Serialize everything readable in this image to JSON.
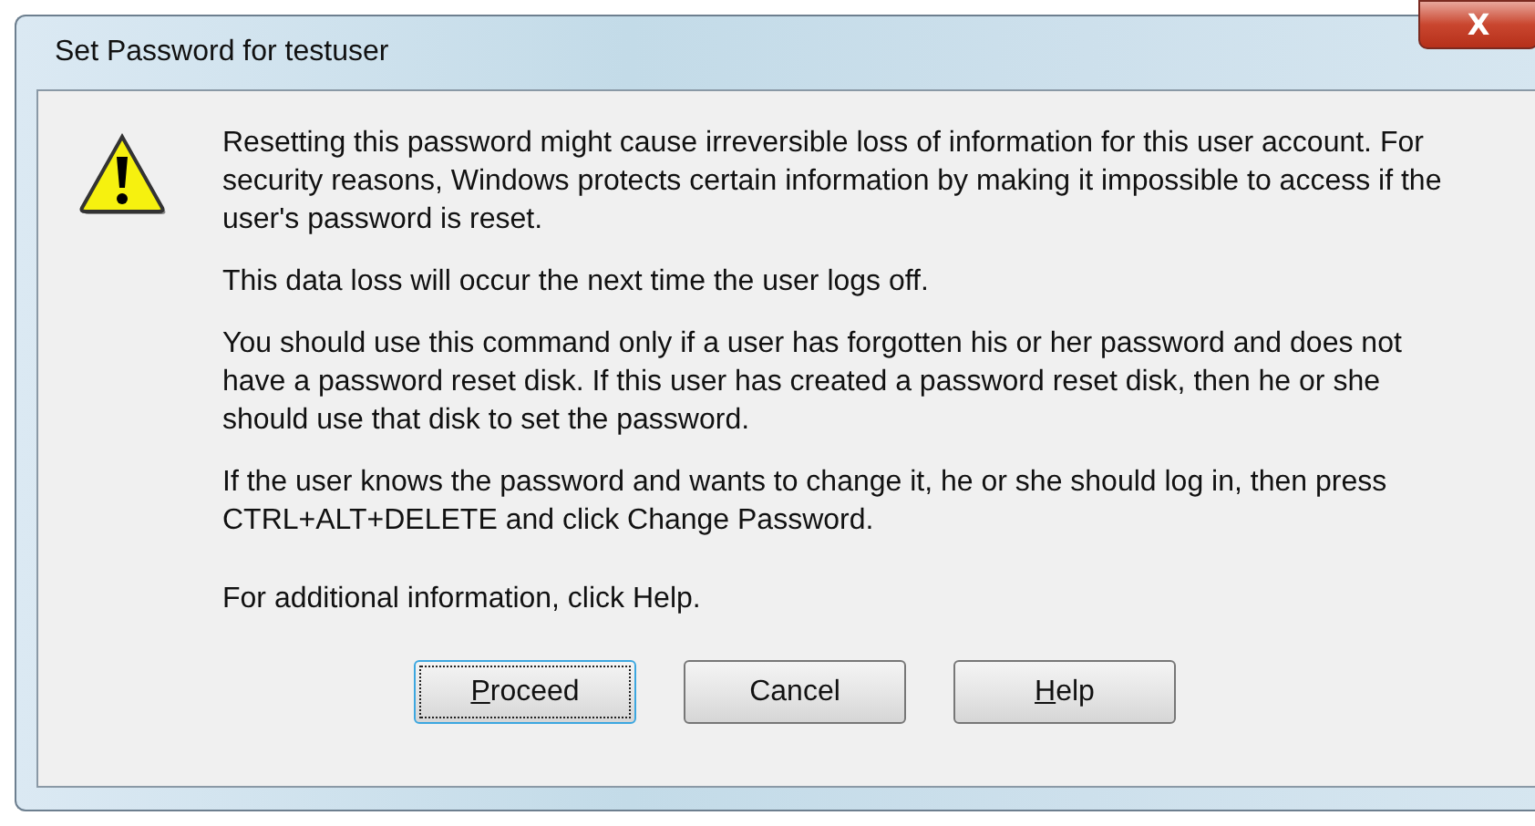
{
  "window": {
    "title": "Set Password for testuser",
    "close_button": "X"
  },
  "message": {
    "paragraphs": [
      "Resetting this password might cause irreversible loss of information for this user account. For security reasons, Windows protects certain information by making it impossible to access if the user's password is reset.",
      "This data loss will occur the next time the user logs off.",
      "You should use this command only if a user has forgotten his or her password and does not have a password reset disk. If this user has created a password reset disk, then he or she should use that disk to set the password.",
      "If the user knows the password and wants to change it, he or she should log in, then press CTRL+ALT+DELETE and click Change Password.",
      "For additional information, click Help."
    ]
  },
  "buttons": [
    {
      "label": "Proceed",
      "underline_first": true,
      "focused": true
    },
    {
      "label": "Cancel",
      "underline_first": false,
      "focused": false
    },
    {
      "label": "Help",
      "underline_first": true,
      "focused": false
    }
  ]
}
